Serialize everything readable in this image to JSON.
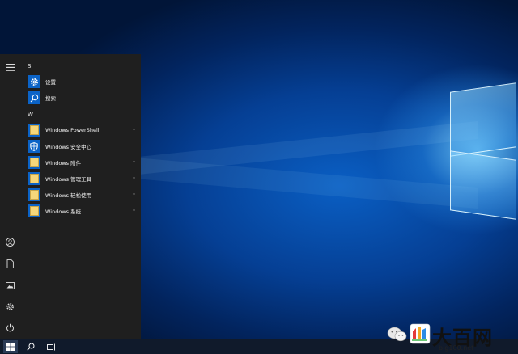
{
  "start_menu": {
    "groups": [
      {
        "header": "S",
        "items": [
          {
            "label": "设置",
            "icon": "gear-icon",
            "expandable": false
          },
          {
            "label": "搜索",
            "icon": "search-icon",
            "expandable": false
          }
        ]
      },
      {
        "header": "W",
        "items": [
          {
            "label": "Windows PowerShell",
            "icon": "folder-icon",
            "expandable": true
          },
          {
            "label": "Windows 安全中心",
            "icon": "shield-icon",
            "expandable": false
          },
          {
            "label": "Windows 附件",
            "icon": "folder-icon",
            "expandable": true
          },
          {
            "label": "Windows 管理工具",
            "icon": "folder-icon",
            "expandable": true
          },
          {
            "label": "Windows 轻松使用",
            "icon": "folder-icon",
            "expandable": true
          },
          {
            "label": "Windows 系统",
            "icon": "folder-icon",
            "expandable": true
          }
        ]
      }
    ],
    "expand_glyph": "⌄",
    "rail_icons": [
      "hamburger-icon",
      "user-icon",
      "document-icon",
      "pictures-icon",
      "settings-icon",
      "power-icon"
    ]
  },
  "taskbar": {
    "icons": [
      "windows-start-icon",
      "search-icon",
      "task-view-icon"
    ]
  },
  "watermark": {
    "text": "大百网",
    "url": "big100.net"
  },
  "colors": {
    "tile": "#0b63c7",
    "menu_bg": "#1f1f1f",
    "desktop": "#0a5fc4"
  }
}
